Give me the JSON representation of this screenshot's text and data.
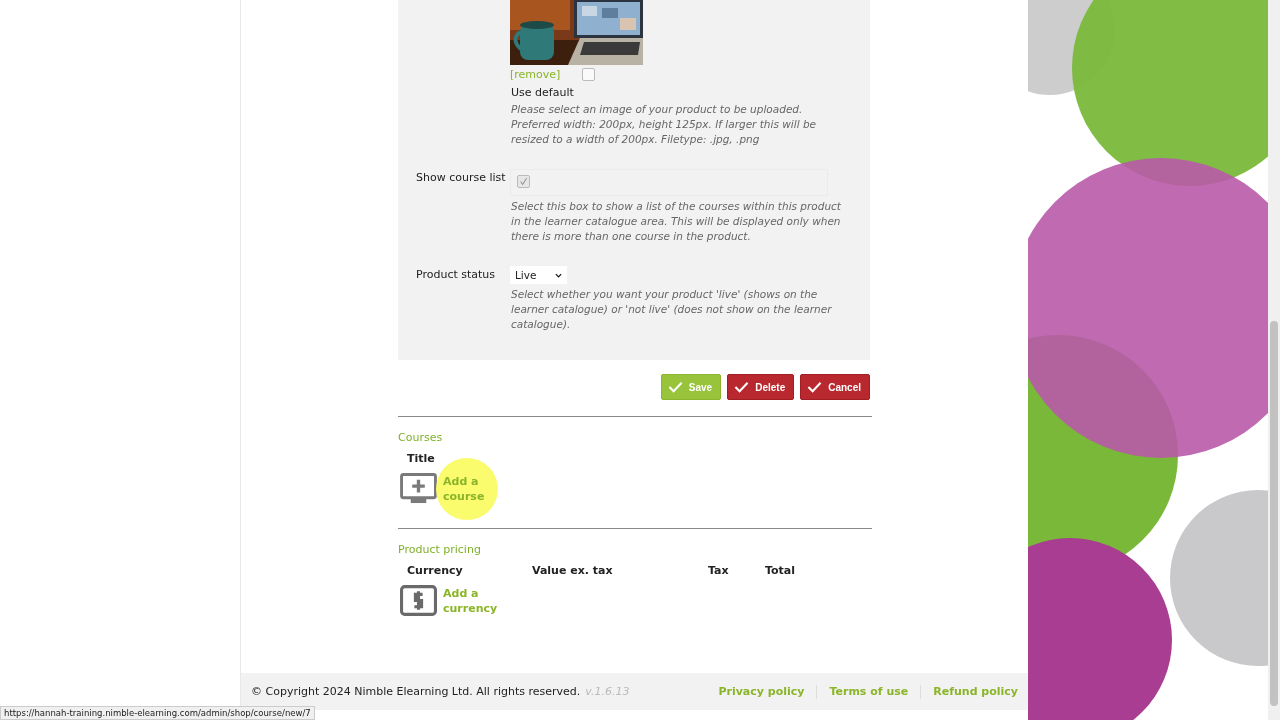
{
  "product_image": {
    "remove_link": "[remove]",
    "use_default": {
      "label": "Use default",
      "checked": false
    },
    "help": "Please select an image of your product to be uploaded. Preferred width: 200px, height 125px. If larger this will be resized to a width of 200px. Filetype: .jpg, .png"
  },
  "fields": [
    {
      "kind": "checkbox",
      "label": "Show course list",
      "checked": true,
      "help": "Select this box to show a list of the courses within this product in the learner catalogue area. This will be displayed only when there is more than one course in the product."
    },
    {
      "kind": "select",
      "label": "Product status",
      "value": "Live",
      "help": "Select whether you want your product 'live' (shows on the learner catalogue) or 'not live' (does not show on the learner catalogue)."
    }
  ],
  "buttons": [
    {
      "label": "Save",
      "kind": "save"
    },
    {
      "label": "Delete",
      "kind": "danger"
    },
    {
      "label": "Cancel",
      "kind": "danger"
    }
  ],
  "courses": {
    "heading": "Courses",
    "columns": [
      "Title"
    ],
    "add_link": "Add a course"
  },
  "pricing": {
    "heading": "Product pricing",
    "columns": [
      "Currency",
      "Value ex. tax",
      "Tax",
      "Total"
    ],
    "add_link": "Add a currency"
  },
  "footer": {
    "copyright": "© Copyright 2024 Nimble Elearning Ltd. All rights reserved.",
    "version": "v.1.6.13",
    "links": [
      "Privacy policy",
      "Terms of use",
      "Refund policy"
    ]
  },
  "status_url": "https://hannah-training.nimble-elearning.com/admin/shop/course/new/7"
}
